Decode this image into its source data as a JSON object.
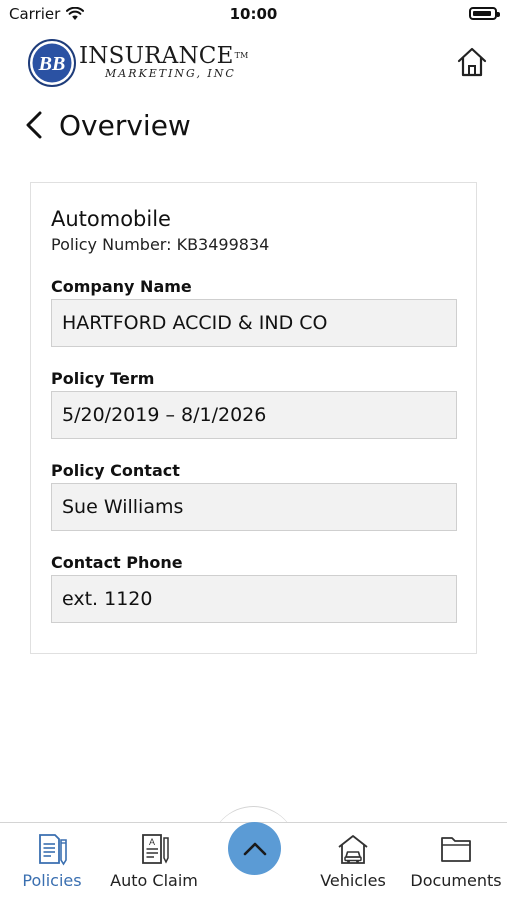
{
  "status_bar": {
    "carrier": "Carrier",
    "time": "10:00",
    "battery_level": 0.9
  },
  "header": {
    "logo": {
      "monogram": "BB",
      "word": "INSURANCE",
      "trademark": "TM",
      "subtitle": "MARKETING, INC"
    }
  },
  "nav": {
    "title": "Overview"
  },
  "policy": {
    "category": "Automobile",
    "policy_number": "Policy Number: KB3499834",
    "fields": [
      {
        "label": "Company Name",
        "value": "HARTFORD ACCID & IND CO"
      },
      {
        "label": "Policy Term",
        "value": "5/20/2019 – 8/1/2026"
      },
      {
        "label": "Policy Contact",
        "value": "Sue Williams"
      },
      {
        "label": "Contact Phone",
        "value": "ext. 1120"
      }
    ]
  },
  "tabbar": {
    "tabs": [
      {
        "label": "Policies",
        "icon": "policies-icon",
        "active": true
      },
      {
        "label": "Auto Claim",
        "icon": "auto-claim-icon",
        "active": false
      },
      {
        "label": "Vehicles",
        "icon": "vehicles-icon",
        "active": false
      },
      {
        "label": "Documents",
        "icon": "documents-icon",
        "active": false
      }
    ],
    "center_button_icon": "chevron-up-icon"
  },
  "colors": {
    "accent": "#3a6fb0",
    "fab": "#5b9bd5",
    "field_bg": "#f2f2f2"
  }
}
